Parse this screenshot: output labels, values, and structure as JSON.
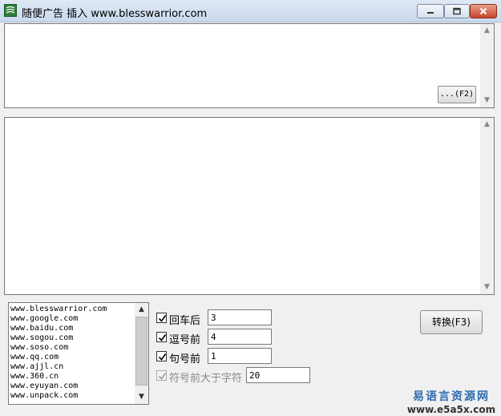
{
  "window": {
    "title": "随便广告 插入 www.blesswarrior.com"
  },
  "top_panel": {
    "text": "",
    "f2_button": "...(F2)"
  },
  "middle_panel": {
    "text": ""
  },
  "url_list": [
    "www.blesswarrior.com",
    "www.google.com",
    "www.baidu.com",
    "www.sogou.com",
    "www.soso.com",
    "www.qq.com",
    "www.ajjl.cn",
    "www.360.cn",
    "www.eyuyan.com",
    "www.unpack.com"
  ],
  "options": [
    {
      "label": "回车后",
      "checked": true,
      "enabled": true,
      "value": "3"
    },
    {
      "label": "逗号前",
      "checked": true,
      "enabled": true,
      "value": "4"
    },
    {
      "label": "句号前",
      "checked": true,
      "enabled": true,
      "value": "1"
    },
    {
      "label": "符号前大于字符",
      "checked": true,
      "enabled": false,
      "value": "20"
    }
  ],
  "convert_button": "转换(F3)",
  "watermark": {
    "cn": "易语言资源网",
    "url": "www.e5a5x.com"
  },
  "colors": {
    "titlebar": "#c9d9ec",
    "close_button": "#c8452b",
    "watermark_blue": "#2e6db0"
  },
  "icons": {
    "app": "app-logo-icon",
    "minimize": "minimize-icon",
    "maximize": "maximize-icon",
    "close": "close-icon",
    "check": "checkmark-icon"
  }
}
